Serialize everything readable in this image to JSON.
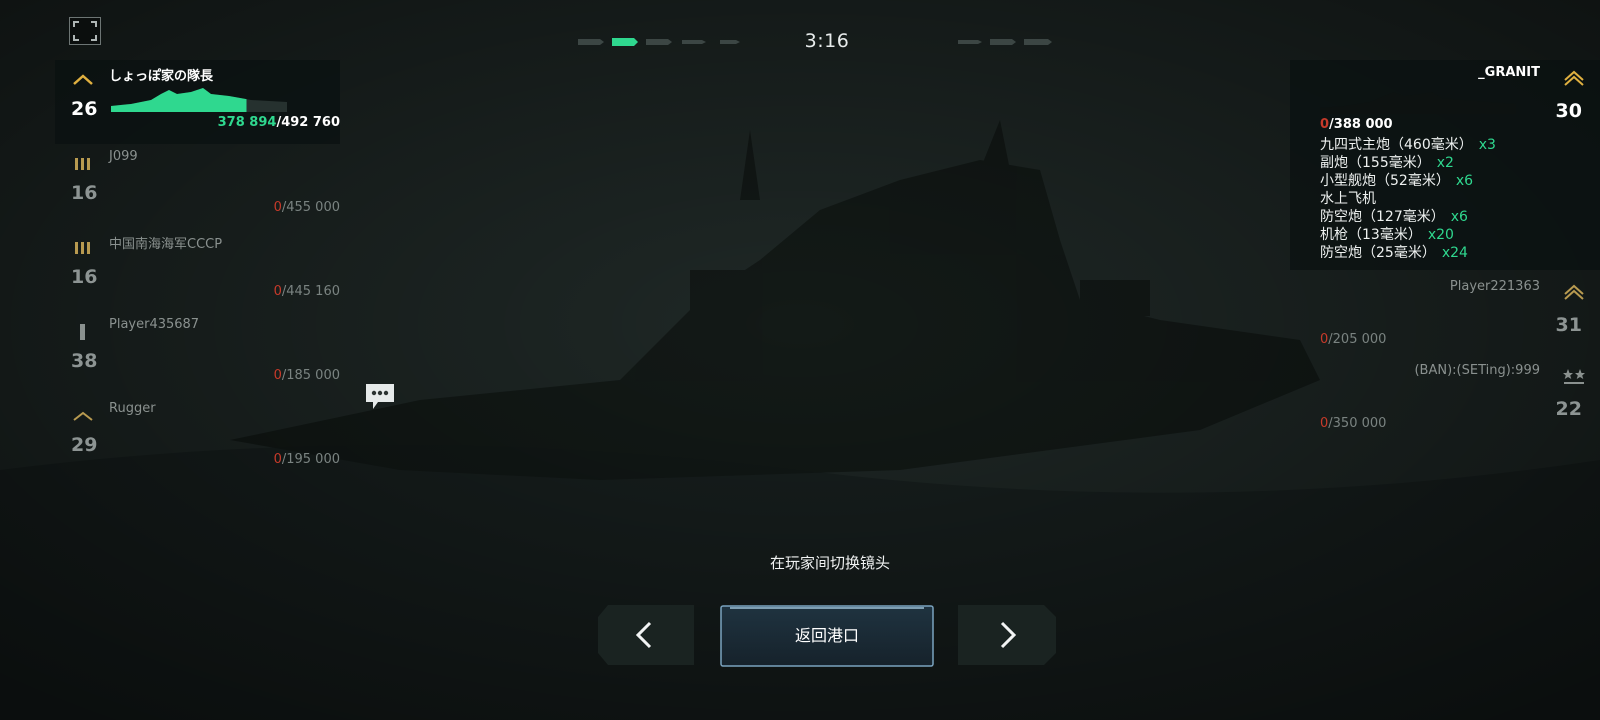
{
  "timer": "3:16",
  "hint": "在玩家间切换镜头",
  "home_button": "返回港口",
  "colors": {
    "accent_green": "#2fd88f",
    "damage_red": "#c73a2a",
    "rank_gold": "#e0b040"
  },
  "icons": {
    "fullscreen": "fullscreen-icon",
    "chat": "chat-bubble-icon",
    "prev": "chevron-left-icon",
    "next": "chevron-right-icon"
  },
  "team_left": [
    {
      "name": "しょっぽ家の隊長",
      "level": "26",
      "hp_current": "378 894",
      "hp_max": "/492 760",
      "selected": true,
      "health_fraction": 0.77
    },
    {
      "name": "J099",
      "level": "16",
      "hp_current": "0",
      "hp_max": "/455 000"
    },
    {
      "name": "中国南海海军CCCP",
      "level": "16",
      "hp_current": "0",
      "hp_max": "/445 160"
    },
    {
      "name": "Player435687",
      "level": "38",
      "hp_current": "0",
      "hp_max": "/185 000"
    },
    {
      "name": "Rugger",
      "level": "29",
      "hp_current": "0",
      "hp_max": "/195 000"
    }
  ],
  "team_right": [
    {
      "name": "_GRANIT",
      "level": "30",
      "hp_current": "0",
      "hp_max": "/388 000",
      "selected": true,
      "weapons": [
        {
          "name": "九四式主炮（460毫米）",
          "count": "x3"
        },
        {
          "name": "副炮（155毫米）",
          "count": "x2"
        },
        {
          "name": "小型舰炮（52毫米）",
          "count": "x6"
        },
        {
          "name": "水上飞机",
          "count": ""
        },
        {
          "name": "防空炮（127毫米）",
          "count": "x6"
        },
        {
          "name": "机枪（13毫米）",
          "count": "x20"
        },
        {
          "name": "防空炮（25毫米）",
          "count": "x24"
        }
      ]
    },
    {
      "name": "Player221363",
      "level": "31",
      "hp_current": "0",
      "hp_max": "/205 000"
    },
    {
      "name": "(BAN):(SETing):999",
      "level": "22",
      "hp_current": "0",
      "hp_max": "/350 000"
    }
  ]
}
